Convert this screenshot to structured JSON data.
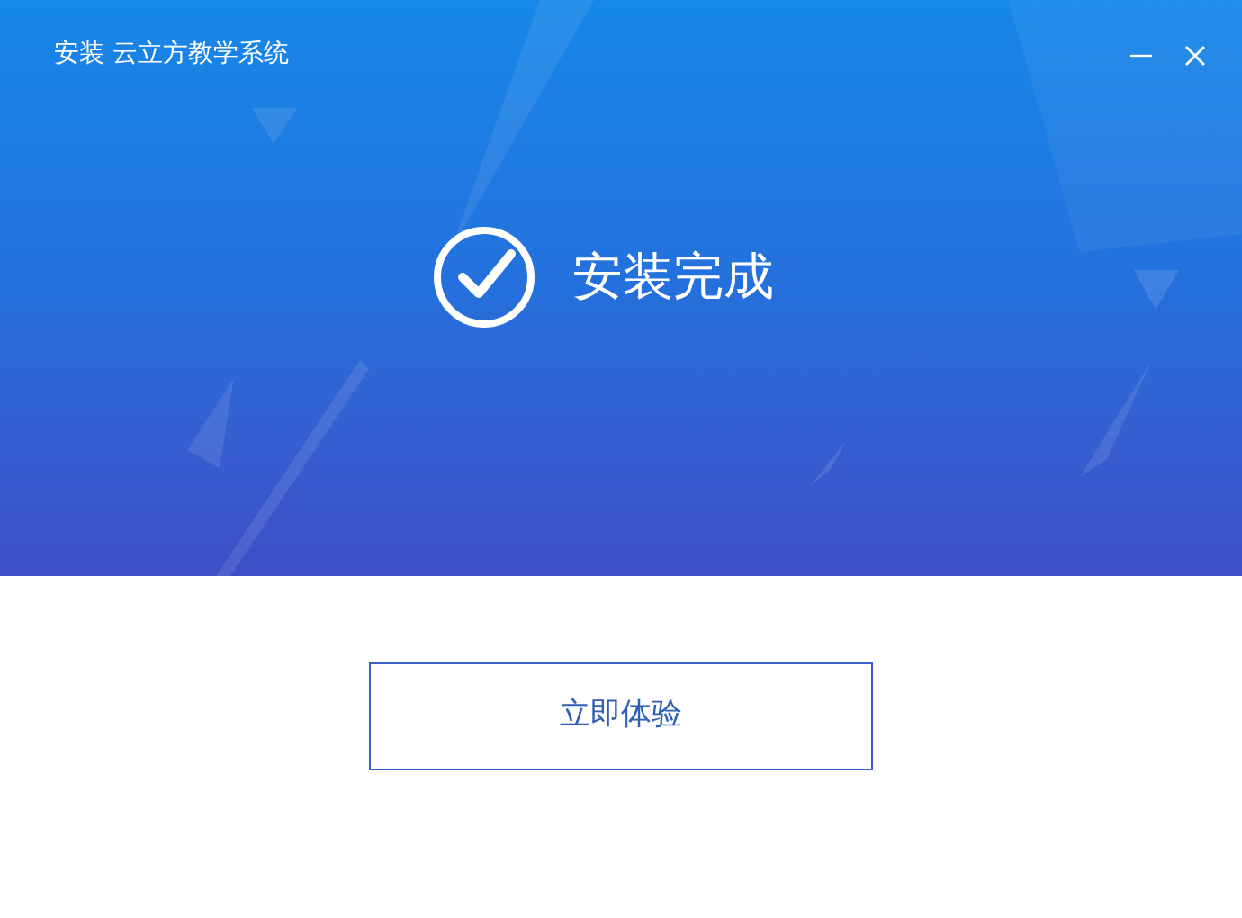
{
  "window": {
    "title": "安装 云立方教学系统"
  },
  "status": {
    "kind": "success",
    "message": "安装完成"
  },
  "buttons": [
    {
      "label": "立即体验"
    }
  ]
}
